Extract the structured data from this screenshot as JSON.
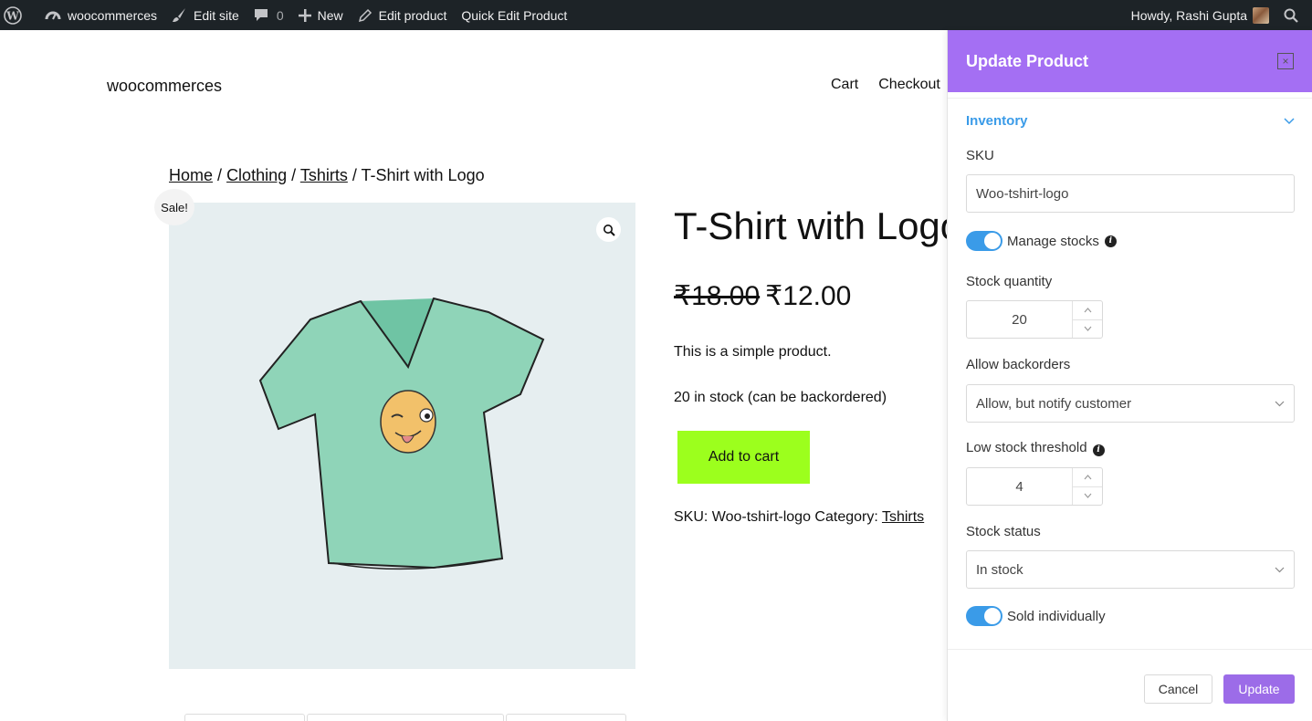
{
  "admin_bar": {
    "site_name": "woocommerces",
    "edit_site": "Edit site",
    "comments_count": "0",
    "new": "New",
    "edit_product": "Edit product",
    "quick_edit": "Quick Edit Product",
    "greeting": "Howdy, Rashi Gupta"
  },
  "site": {
    "title": "woocommerces",
    "nav": [
      "Cart",
      "Checkout"
    ]
  },
  "breadcrumb": {
    "home": "Home",
    "clothing": "Clothing",
    "tshirts": "Tshirts",
    "current": "/ T-Shirt with Logo",
    "sep": "/"
  },
  "product": {
    "sale_badge": "Sale!",
    "title": "T-Shirt with Logo",
    "regular_price": "₹18.00",
    "sale_price": "₹12.00",
    "short_description": "This is a simple product.",
    "stock_text": "20 in stock (can be backordered)",
    "add_to_cart": "Add to cart",
    "sku_label": "SKU: Woo-tshirt-logo Category:",
    "category": "Tshirts"
  },
  "panel": {
    "title": "Update Product",
    "close": "×",
    "section": "Inventory",
    "sku_label": "SKU",
    "sku_value": "Woo-tshirt-logo",
    "manage_stocks_label": "Manage stocks",
    "stock_qty_label": "Stock quantity",
    "stock_qty_value": "20",
    "backorders_label": "Allow backorders",
    "backorders_value": "Allow, but notify customer",
    "low_stock_label": "Low stock threshold",
    "low_stock_value": "4",
    "stock_status_label": "Stock status",
    "stock_status_value": "In stock",
    "sold_individually_label": "Sold individually",
    "cancel": "Cancel",
    "update": "Update"
  },
  "colors": {
    "admin_bar": "#1d2327",
    "panel_header": "#a46ff3",
    "accent_blue": "#3a9be8",
    "add_to_cart": "#9cff1d",
    "update_button": "#9c6ce8"
  },
  "icons": [
    "wordpress-icon",
    "dashboard-icon",
    "brush-icon",
    "comment-icon",
    "plus-icon",
    "pencil-icon",
    "search-icon",
    "zoom-icon",
    "chevron-down-icon",
    "info-icon"
  ]
}
